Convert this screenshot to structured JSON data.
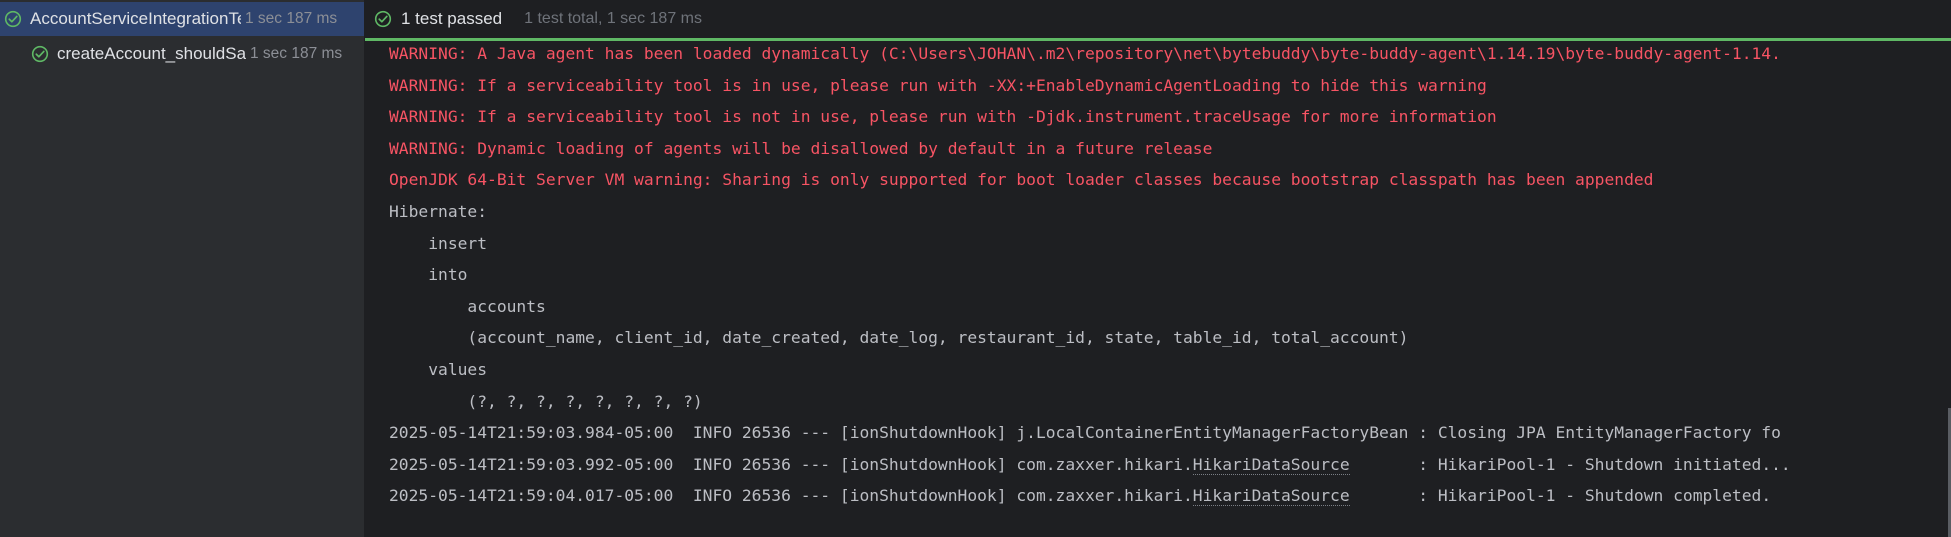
{
  "test_tree": {
    "root": {
      "name": "AccountServiceIntegrationTest",
      "time": "1 sec 187 ms",
      "status_icon": "check-circle-icon"
    },
    "child": {
      "name": "createAccount_shouldSaveAccount",
      "time": "1 sec 187 ms",
      "status_icon": "check-circle-icon"
    }
  },
  "status": {
    "label": "1 test passed",
    "summary": "1 test total, 1 sec 187 ms",
    "progress": 1.0
  },
  "colors": {
    "pass": "#5fb865",
    "warning": "#f75464",
    "info": "#bcbec4",
    "selected": "#2e436e"
  },
  "console": {
    "lines": [
      {
        "kind": "warn",
        "text": "WARNING: A Java agent has been loaded dynamically (C:\\Users\\JOHAN\\.m2\\repository\\net\\bytebuddy\\byte-buddy-agent\\1.14.19\\byte-buddy-agent-1.14."
      },
      {
        "kind": "warn",
        "text": "WARNING: If a serviceability tool is in use, please run with -XX:+EnableDynamicAgentLoading to hide this warning"
      },
      {
        "kind": "warn",
        "text": "WARNING: If a serviceability tool is not in use, please run with -Djdk.instrument.traceUsage for more information"
      },
      {
        "kind": "warn",
        "text": "WARNING: Dynamic loading of agents will be disallowed by default in a future release"
      },
      {
        "kind": "warn",
        "text": "OpenJDK 64-Bit Server VM warning: Sharing is only supported for boot loader classes because bootstrap classpath has been appended"
      },
      {
        "kind": "info",
        "text": "Hibernate: "
      },
      {
        "kind": "info",
        "text": "    insert "
      },
      {
        "kind": "info",
        "text": "    into"
      },
      {
        "kind": "info",
        "text": "        accounts"
      },
      {
        "kind": "info",
        "text": "        (account_name, client_id, date_created, date_log, restaurant_id, state, table_id, total_account) "
      },
      {
        "kind": "info",
        "text": "    values"
      },
      {
        "kind": "info",
        "text": "        (?, ?, ?, ?, ?, ?, ?, ?)"
      },
      {
        "kind": "info",
        "text": "2025-05-14T21:59:03.984-05:00  INFO 26536 --- [ionShutdownHook] j.LocalContainerEntityManagerFactoryBean : Closing JPA EntityManagerFactory fo"
      },
      {
        "kind": "log",
        "prefix": "2025-05-14T21:59:03.992-05:00  INFO 26536 --- [ionShutdownHook] com.zaxxer.hikari.",
        "link": "HikariDataSource",
        "suffix": "       : HikariPool-1 - Shutdown initiated..."
      },
      {
        "kind": "log",
        "prefix": "2025-05-14T21:59:04.017-05:00  INFO 26536 --- [ionShutdownHook] com.zaxxer.hikari.",
        "link": "HikariDataSource",
        "suffix": "       : HikariPool-1 - Shutdown completed."
      }
    ]
  }
}
